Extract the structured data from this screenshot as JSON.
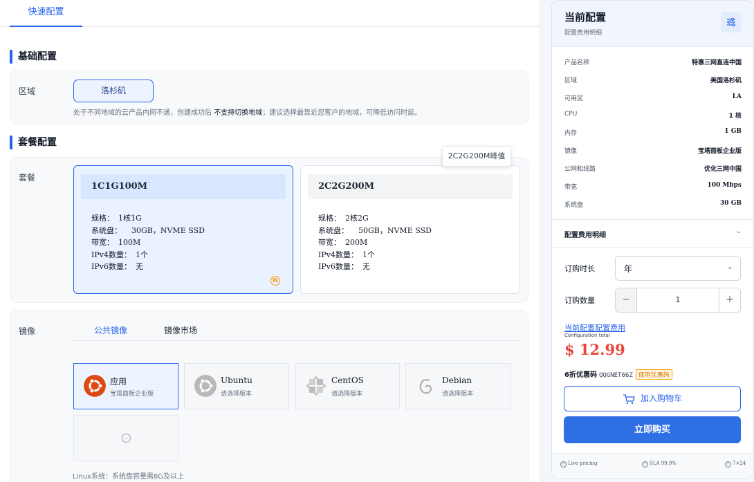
{
  "tabs": {
    "quick": "快速配置"
  },
  "sections": {
    "basic": "基础配置",
    "package": "套餐配置"
  },
  "region": {
    "label": "区域",
    "button": "洛杉矶",
    "hint_pre": "处于不同地域的云产品内网不通，创建成功后",
    "hint_bold": "不支持切换地域",
    "hint_post": "；建议选择最靠近您客户的地域，可降低访问时延。"
  },
  "package": {
    "label": "套餐",
    "tooltip": "2C2G200M峰值",
    "plans": [
      {
        "name": "1C1G100M",
        "specs": [
          {
            "k": "规格：",
            "v": "1核1G"
          },
          {
            "k": "系统盘：",
            "v": "30GB，NVME SSD"
          },
          {
            "k": "带宽：",
            "v": "100M"
          },
          {
            "k": "IPv4数量：",
            "v": "1个"
          },
          {
            "k": "IPv6数量：",
            "v": "无"
          }
        ]
      },
      {
        "name": "2C2G200M",
        "specs": [
          {
            "k": "规格：",
            "v": "2核2G"
          },
          {
            "k": "系统盘：",
            "v": "50GB，NVME SSD"
          },
          {
            "k": "带宽：",
            "v": "200M"
          },
          {
            "k": "IPv4数量：",
            "v": "1个"
          },
          {
            "k": "IPv6数量：",
            "v": "无"
          }
        ]
      }
    ]
  },
  "image": {
    "label": "镜像",
    "tabs": [
      "公共镜像",
      "镜像市场"
    ],
    "options": [
      {
        "name": "应用",
        "sub": "宝塔面板企业版",
        "icon": "ubuntu-icon"
      },
      {
        "name": "Ubuntu",
        "sub": "请选择版本",
        "icon": "ubuntu-icon"
      },
      {
        "name": "CentOS",
        "sub": "请选择版本",
        "icon": "centos-icon"
      },
      {
        "name": "Debian",
        "sub": "请选择版本",
        "icon": "debian-icon"
      }
    ],
    "linux_note": "Linux系统：系统盘容量需8G及以上"
  },
  "summary": {
    "title": "当前配置",
    "subtitle": "配置费用明细",
    "rows": [
      {
        "k": "产品名称",
        "v": "特惠三网直连中国"
      },
      {
        "k": "区域",
        "v": "美国洛杉矶"
      },
      {
        "k": "可用区",
        "v": "LA"
      },
      {
        "k": "CPU",
        "v": "1 核"
      },
      {
        "k": "内存",
        "v": "1 GB"
      },
      {
        "k": "镜像",
        "v": "宝塔面板企业版"
      },
      {
        "k": "公网和线路",
        "v": "优化三网中国"
      },
      {
        "k": "带宽",
        "v": "100 Mbps"
      },
      {
        "k": "系统盘",
        "v": "30 GB"
      }
    ],
    "fee_details": "配置费用明细",
    "duration_label": "订购时长",
    "duration_value": "年",
    "quantity_label": "订购数量",
    "quantity_value": "1",
    "total_link": "当前配置配置费用",
    "total_en": "Configuration total",
    "price": "$ 12.99",
    "coupon_label": "6折优惠码",
    "coupon_code": "QQGNET66Z",
    "coupon_use": "使用优惠码",
    "cart_button": "加入购物车",
    "buy_button": "立即购买",
    "footer": [
      "Live pricing",
      "SLA 99.9%",
      "7×24"
    ]
  },
  "colors": {
    "accent": "#2563eb",
    "price": "#e8453c",
    "coupon": "#f59e0b"
  }
}
